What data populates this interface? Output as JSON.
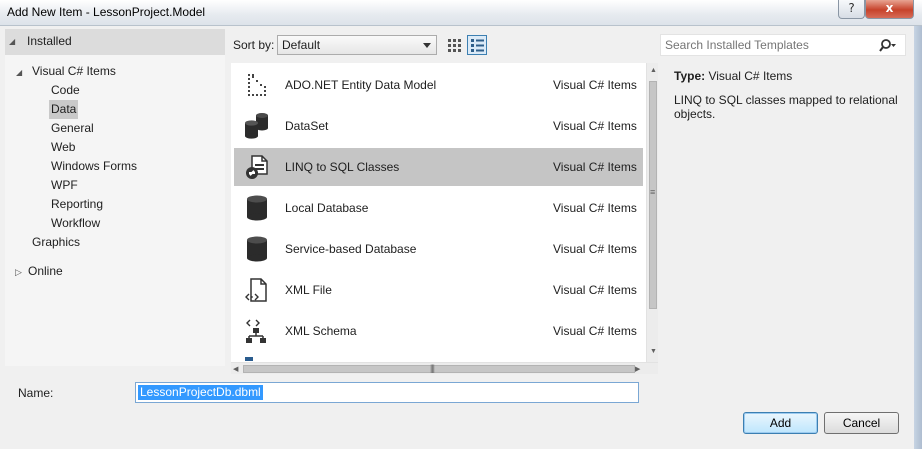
{
  "window": {
    "title": "Add New Item - LessonProject.Model",
    "help_glyph": "?",
    "close_glyph": "x"
  },
  "tree": {
    "installed_label": "Installed",
    "root_label": "Visual C# Items",
    "children": [
      "Code",
      "Data",
      "General",
      "Web",
      "Windows Forms",
      "WPF",
      "Reporting",
      "Workflow"
    ],
    "selected_child": "Data",
    "graphics_label": "Graphics",
    "online_label": "Online"
  },
  "toolbar": {
    "sort_label": "Sort by:",
    "sort_value": "Default"
  },
  "search": {
    "placeholder": "Search Installed Templates"
  },
  "templates": [
    {
      "name": "ADO.NET Entity Data Model",
      "category": "Visual C# Items",
      "icon": "entity-model-icon"
    },
    {
      "name": "DataSet",
      "category": "Visual C# Items",
      "icon": "dataset-icon"
    },
    {
      "name": "LINQ to SQL Classes",
      "category": "Visual C# Items",
      "icon": "linq-classes-icon",
      "selected": true
    },
    {
      "name": "Local Database",
      "category": "Visual C# Items",
      "icon": "database-icon"
    },
    {
      "name": "Service-based Database",
      "category": "Visual C# Items",
      "icon": "database-icon"
    },
    {
      "name": "XML File",
      "category": "Visual C# Items",
      "icon": "xml-file-icon"
    },
    {
      "name": "XML Schema",
      "category": "Visual C# Items",
      "icon": "xml-schema-icon"
    }
  ],
  "description": {
    "type_label": "Type:",
    "type_value": "Visual C# Items",
    "text": "LINQ to SQL classes mapped to relational objects."
  },
  "form": {
    "name_label": "Name:",
    "name_value": "LessonProjectDb.dbml"
  },
  "buttons": {
    "add": "Add",
    "cancel": "Cancel"
  }
}
